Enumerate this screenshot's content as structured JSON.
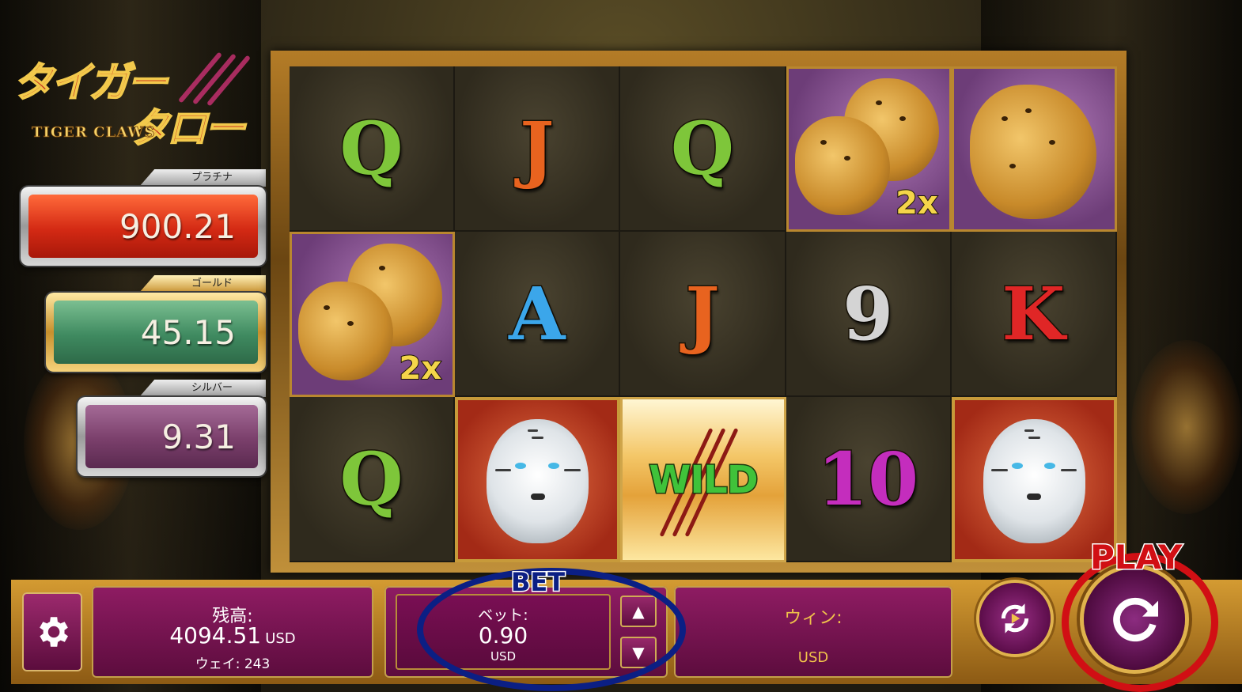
{
  "game": {
    "title_jp_line1": "タイガー",
    "title_jp_line2": "タロー",
    "title_en": "TIGER CLAWS"
  },
  "jackpots": [
    {
      "label": "プラチナ",
      "value": "900.21",
      "color": "#d9331a"
    },
    {
      "label": "ゴールド",
      "value": "45.15",
      "color": "#3f8a60"
    },
    {
      "label": "シルバー",
      "value": "9.31",
      "color": "#7a3f6b"
    }
  ],
  "reels": {
    "rows": [
      [
        "Q",
        "J",
        "Q",
        "leopard-2x",
        "leopard"
      ],
      [
        "leopard-2x",
        "A",
        "J",
        "9",
        "K"
      ],
      [
        "Q",
        "white-tiger",
        "WILD",
        "10",
        "white-tiger"
      ]
    ],
    "multiplier_label": "2x",
    "wild_label": "WILD"
  },
  "bottom_bar": {
    "balance_label": "残高:",
    "balance_value": "4094.51",
    "balance_currency": "USD",
    "ways_label": "ウェイ: 243",
    "bet_label": "ベット:",
    "bet_value": "0.90",
    "bet_currency": "USD",
    "win_label": "ウィン:",
    "win_currency": "USD",
    "up_arrow": "▲",
    "down_arrow": "▼"
  },
  "annotations": {
    "bet_callout": "BET",
    "play_callout": "PLAY"
  },
  "icons": {
    "settings": "gear-icon",
    "autoplay": "autoplay-icon",
    "spin": "spin-icon"
  }
}
